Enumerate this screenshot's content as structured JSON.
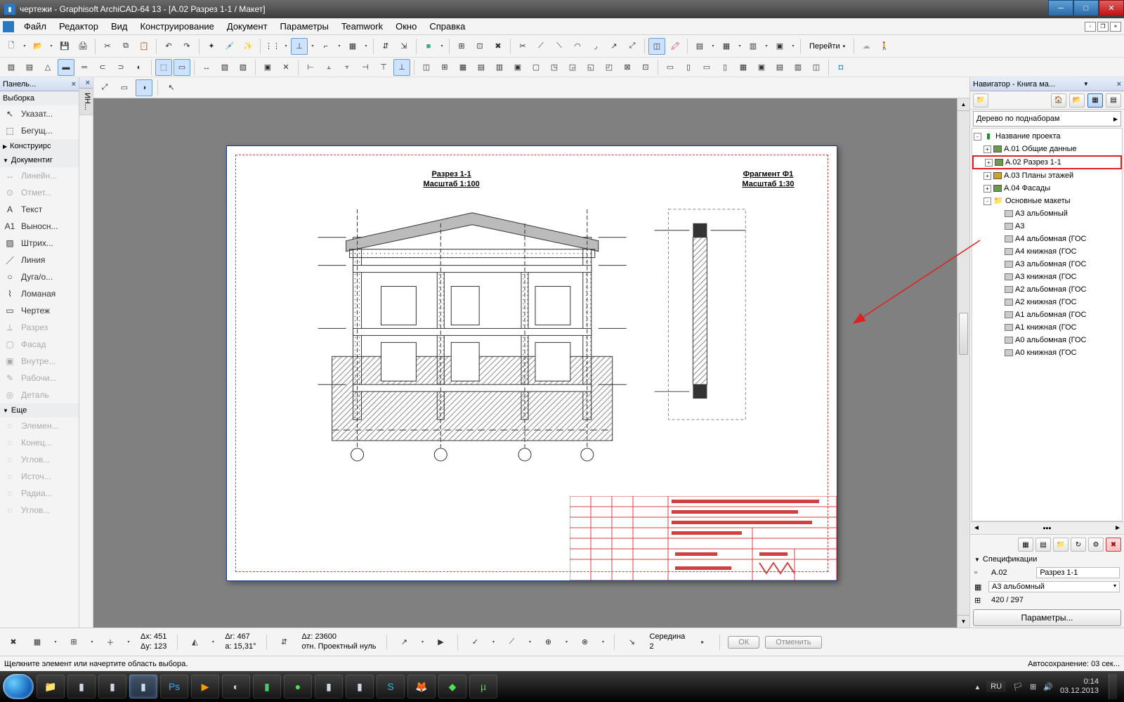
{
  "titlebar": {
    "text": "чертежи - Graphisoft ArchiCAD-64 13 - [A.02 Разрез 1-1 / Макет]"
  },
  "menu": {
    "items": [
      "Файл",
      "Редактор",
      "Вид",
      "Конструирование",
      "Документ",
      "Параметры",
      "Teamwork",
      "Окно",
      "Справка"
    ]
  },
  "goto": {
    "label": "Перейти"
  },
  "toolbox": {
    "header": "Панель...",
    "selection_group": "Выборка",
    "pointer": "Указат...",
    "marquee": "Бегущ...",
    "construct_group": "Конструирс",
    "document_group": "Документиг",
    "items": [
      {
        "label": "Линейн...",
        "disabled": true
      },
      {
        "label": "Отмет...",
        "disabled": true
      },
      {
        "label": "Текст"
      },
      {
        "label": "Выносн..."
      },
      {
        "label": "Штрих..."
      },
      {
        "label": "Линия"
      },
      {
        "label": "Дуга/о..."
      },
      {
        "label": "Ломаная"
      },
      {
        "label": "Чертеж"
      },
      {
        "label": "Разрез",
        "disabled": true
      },
      {
        "label": "Фасад",
        "disabled": true
      },
      {
        "label": "Внутре...",
        "disabled": true
      },
      {
        "label": "Рабочи...",
        "disabled": true
      },
      {
        "label": "Деталь",
        "disabled": true
      }
    ],
    "more_group": "Еще",
    "more_items": [
      {
        "label": "Элемен...",
        "disabled": true
      },
      {
        "label": "Конец...",
        "disabled": true
      },
      {
        "label": "Углов...",
        "disabled": true
      },
      {
        "label": "Источ...",
        "disabled": true
      },
      {
        "label": "Радиа...",
        "disabled": true
      },
      {
        "label": "Углов...",
        "disabled": true
      }
    ]
  },
  "vtabs": [
    "ИН..."
  ],
  "drawing": {
    "section_title": "Разрез 1-1",
    "section_scale": "Масштаб 1:100",
    "fragment_title": "Фрагмент Ф1",
    "fragment_scale": "Масштаб 1:30"
  },
  "navigator": {
    "title": "Навигатор - Книга ма...",
    "combo": "Дерево по поднаборам",
    "root": "Название проекта",
    "items": [
      {
        "label": "А.01 Общие данные",
        "icon": "layout"
      },
      {
        "label": "А.02 Разрез 1-1",
        "icon": "layout",
        "highlight": true
      },
      {
        "label": "А.03 Планы этажей",
        "icon": "layout-y"
      },
      {
        "label": "А.04 Фасады",
        "icon": "layout"
      }
    ],
    "masters_label": "Основные макеты",
    "masters": [
      "А3 альбомный",
      "А3",
      "А4 альбомная (ГОС",
      "А4 книжная (ГОС",
      "А3 альбомная (ГОС",
      "А3 книжная (ГОС",
      "А2 альбомная (ГОС",
      "А2 книжная (ГОС",
      "А1 альбомная (ГОС",
      "А1 книжная (ГОС",
      "А0 альбомная (ГОС",
      "А0 книжная (ГОС"
    ],
    "spec_header": "Спецификации",
    "spec_code": "А.02",
    "spec_name": "Разрез 1-1",
    "spec_master": "А3 альбомный",
    "spec_size": "420 / 297",
    "params_btn": "Параметры..."
  },
  "coords": {
    "dx": "Δx: 451",
    "dy": "Δy: 123",
    "dr": "Δr: 467",
    "da": "a: 15,31°",
    "dz": "Δz: 23600",
    "ref": "отн. Проектный нуль",
    "mode": "Середина",
    "mode_val": "2",
    "ok": "ОК",
    "cancel": "Отменить"
  },
  "status": {
    "hint": "Щелкните элемент или начертите область выбора.",
    "autosave": "Автосохранение: 03 сек..."
  },
  "taskbar": {
    "lang": "RU",
    "time": "0:14",
    "date": "03.12.2013"
  }
}
